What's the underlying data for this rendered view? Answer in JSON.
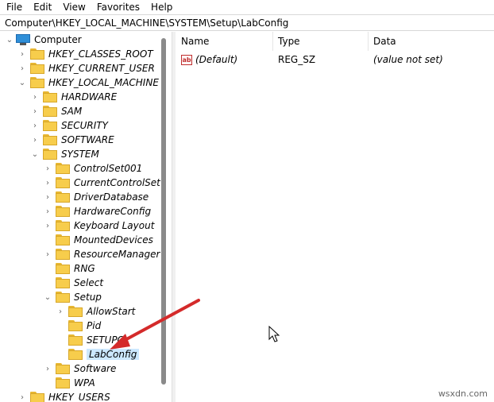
{
  "menu": [
    "File",
    "Edit",
    "View",
    "Favorites",
    "Help"
  ],
  "address": "Computer\\HKEY_LOCAL_MACHINE\\SYSTEM\\Setup\\LabConfig",
  "tree": [
    {
      "label": "Computer"
    },
    {
      "label": "HKEY_CLASSES_ROOT"
    },
    {
      "label": "HKEY_CURRENT_USER"
    },
    {
      "label": "HKEY_LOCAL_MACHINE"
    },
    {
      "label": "HARDWARE"
    },
    {
      "label": "SAM"
    },
    {
      "label": "SECURITY"
    },
    {
      "label": "SOFTWARE"
    },
    {
      "label": "SYSTEM"
    },
    {
      "label": "ControlSet001"
    },
    {
      "label": "CurrentControlSet"
    },
    {
      "label": "DriverDatabase"
    },
    {
      "label": "HardwareConfig"
    },
    {
      "label": "Keyboard Layout"
    },
    {
      "label": "MountedDevices"
    },
    {
      "label": "ResourceManager"
    },
    {
      "label": "RNG"
    },
    {
      "label": "Select"
    },
    {
      "label": "Setup"
    },
    {
      "label": "AllowStart"
    },
    {
      "label": "Pid"
    },
    {
      "label": "SETUPC"
    },
    {
      "label": "LabConfig"
    },
    {
      "label": "Software"
    },
    {
      "label": "WPA"
    },
    {
      "label": "HKEY_USERS"
    }
  ],
  "columns": {
    "name": "Name",
    "type": "Type",
    "data": "Data"
  },
  "values": [
    {
      "name": "(Default)",
      "type": "REG_SZ",
      "data": "(value not set)"
    }
  ],
  "watermark": "wsxdn.com"
}
